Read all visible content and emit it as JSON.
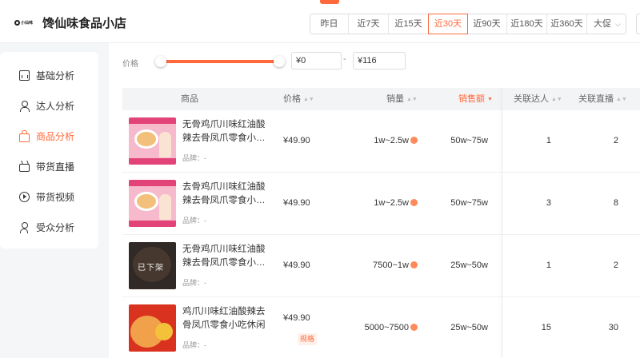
{
  "header": {
    "logo_text": "小仙味",
    "store_title": "馋仙味食品小店",
    "date_tabs": [
      {
        "label": "昨日",
        "active": false
      },
      {
        "label": "近7天",
        "active": false
      },
      {
        "label": "近15天",
        "active": false
      },
      {
        "label": "近30天",
        "active": true
      },
      {
        "label": "近90天",
        "active": false
      },
      {
        "label": "近180天",
        "active": false
      },
      {
        "label": "近360天",
        "active": false
      }
    ],
    "promo_label": "大促"
  },
  "sidebar": {
    "items": [
      {
        "label": "基础分析",
        "icon": "chart-icon",
        "active": false
      },
      {
        "label": "达人分析",
        "icon": "user-icon",
        "active": false
      },
      {
        "label": "商品分析",
        "icon": "bag-icon",
        "active": true
      },
      {
        "label": "带货直播",
        "icon": "live-icon",
        "active": false
      },
      {
        "label": "带货视频",
        "icon": "play-icon",
        "active": false
      },
      {
        "label": "受众分析",
        "icon": "audience-icon",
        "active": false
      }
    ]
  },
  "filter": {
    "price_label": "价格",
    "min_value": "¥0",
    "max_value": "¥116",
    "dash": "-"
  },
  "table": {
    "columns": [
      "商品",
      "价格",
      "销量",
      "销售额",
      "关联达人",
      "关联直播"
    ],
    "sorted_column": "销售额",
    "rows": [
      {
        "name": "无骨鸡爪川味红油酸辣去骨凤爪零食小吃休闲",
        "brand": "品牌：-",
        "price": "¥49.90",
        "spec": "",
        "sales": "1w~2.5w",
        "revenue": "50w~75w",
        "influencers": "1",
        "lives": "2",
        "thumb": "pink"
      },
      {
        "name": "去骨鸡爪川味红油酸辣去骨凤爪零食小吃休闲",
        "brand": "品牌：-",
        "price": "¥49.90",
        "spec": "",
        "sales": "1w~2.5w",
        "revenue": "50w~75w",
        "influencers": "3",
        "lives": "8",
        "thumb": "pink"
      },
      {
        "name": "无骨鸡爪川味红油酸辣去骨凤爪零食小吃休闲",
        "brand": "品牌：-",
        "price": "¥49.90",
        "spec": "",
        "sales": "7500~1w",
        "revenue": "25w~50w",
        "influencers": "1",
        "lives": "2",
        "thumb": "dark",
        "thumb_tag": "已下架"
      },
      {
        "name": "鸡爪川味红油酸辣去骨凤爪零食小吃休闲",
        "brand": "品牌：-",
        "price": "¥49.90",
        "spec": "规格",
        "sales": "5000~7500",
        "revenue": "25w~50w",
        "influencers": "15",
        "lives": "30",
        "thumb": "red"
      }
    ]
  },
  "colors": {
    "accent": "#ff6a3d"
  }
}
